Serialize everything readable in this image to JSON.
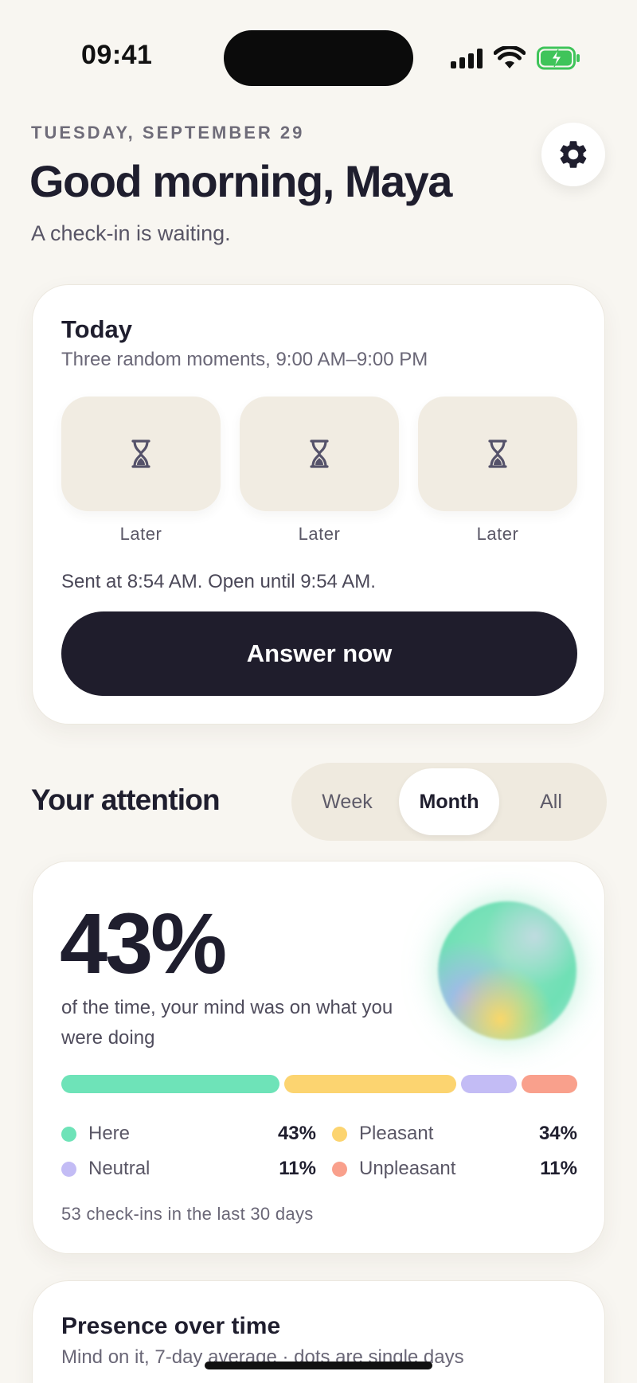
{
  "status_bar": {
    "time": "09:41",
    "signal_icon": "cellular-signal-icon",
    "wifi_icon": "wifi-icon",
    "battery_icon": "battery-charging-icon"
  },
  "header": {
    "date": "TUESDAY, SEPTEMBER 29",
    "greeting": "Good morning, Maya",
    "subtitle": "A check-in is waiting.",
    "settings_icon": "gear-icon"
  },
  "today": {
    "title": "Today",
    "subtitle": "Three random moments, 9:00 AM–9:00 PM",
    "slots": [
      {
        "icon": "hourglass-icon",
        "label": "Later"
      },
      {
        "icon": "hourglass-icon",
        "label": "Later"
      },
      {
        "icon": "hourglass-icon",
        "label": "Later"
      }
    ],
    "sent_text": "Sent at 8:54 AM. Open until 9:54 AM.",
    "answer_label": "Answer now"
  },
  "attention": {
    "title": "Your attention",
    "tabs": [
      {
        "label": "Week",
        "active": false
      },
      {
        "label": "Month",
        "active": true
      },
      {
        "label": "All",
        "active": false
      }
    ],
    "selected_tab": "Month"
  },
  "stats": {
    "big_percent": "43%",
    "description": "of the time, your mind was on what you were doing",
    "breakdown": [
      {
        "label": "Here",
        "value": "43%",
        "fraction": 0.43,
        "color": "#6ee3b8"
      },
      {
        "label": "Pleasant",
        "value": "34%",
        "fraction": 0.34,
        "color": "#fcd470"
      },
      {
        "label": "Neutral",
        "value": "11%",
        "fraction": 0.11,
        "color": "#c3bcf5"
      },
      {
        "label": "Unpleasant",
        "value": "11%",
        "fraction": 0.11,
        "color": "#f9a08c"
      }
    ],
    "checkins_text": "53 check-ins in the last 30 days"
  },
  "presence": {
    "title": "Presence over time",
    "subtitle": "Mind on it, 7-day average · dots are single days"
  }
}
